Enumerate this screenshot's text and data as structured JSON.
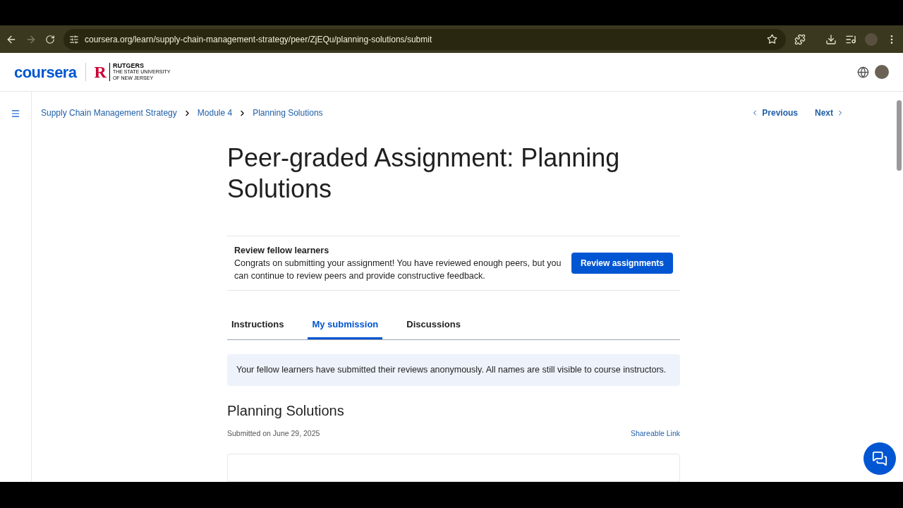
{
  "browser": {
    "url": "coursera.org/learn/supply-chain-management-strategy/peer/ZjEQu/planning-solutions/submit"
  },
  "header": {
    "logo": "coursera",
    "partner_mark": "R",
    "partner_name": "RUTGERS",
    "partner_sub": "THE STATE UNIVERSITY OF NEW JERSEY"
  },
  "breadcrumbs": [
    "Supply Chain Management Strategy",
    "Module 4",
    "Planning Solutions"
  ],
  "nav": {
    "previous": "Previous",
    "next": "Next"
  },
  "title": "Peer-graded Assignment: Planning Solutions",
  "review_banner": {
    "heading": "Review fellow learners",
    "text": "Congrats on submitting your assignment! You have reviewed enough peers, but you can continue to review peers and provide constructive feedback.",
    "button": "Review assignments"
  },
  "tabs": [
    {
      "label": "Instructions",
      "selected": false
    },
    {
      "label": "My submission",
      "selected": true
    },
    {
      "label": "Discussions",
      "selected": false
    }
  ],
  "notice": "Your fellow learners have submitted their reviews anonymously. All names are still visible to course instructors.",
  "submission": {
    "title": "Planning Solutions",
    "date": "Submitted on June 29, 2025",
    "link": "Shareable Link"
  }
}
